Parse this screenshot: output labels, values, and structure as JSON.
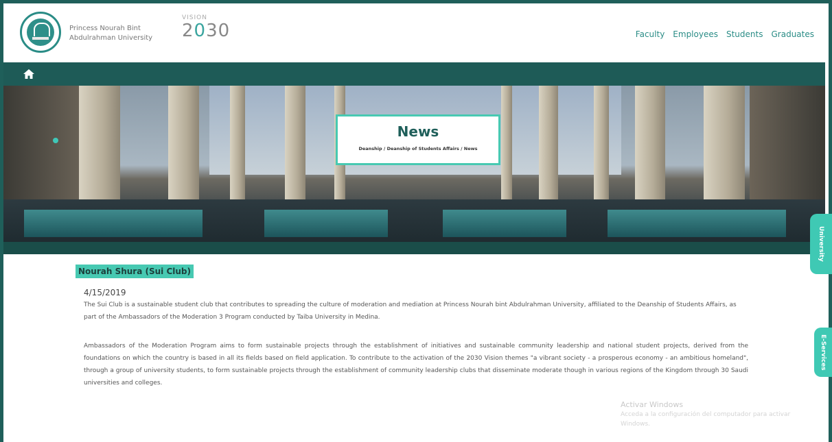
{
  "header": {
    "university_name_line1": "Princess Nourah Bint",
    "university_name_line2": "Abdulrahman University",
    "vision_top": "VISION",
    "vision_number_a": "2",
    "vision_number_b": "0",
    "vision_number_c": "30",
    "nav": [
      "Faculty",
      "Employees",
      "Students",
      "Graduates"
    ]
  },
  "hero": {
    "title": "News",
    "breadcrumb": "Deanship / Deanship of Students Affairs / News"
  },
  "side_tabs": [
    "University",
    "E-Services"
  ],
  "article": {
    "headline": "Nourah Shura (Sui Club)",
    "date": "4/15/2019",
    "paragraph1": "The Sui Club is a sustainable student club that contributes to spreading the culture of moderation and mediation at Princess Nourah bint Abdulrahman University, affiliated to the Deanship of Students Affairs, as part of the Ambassadors of the Moderation 3 Program conducted by Taiba University in Medina.",
    "paragraph2": "Ambassadors of the Moderation Program aims to form sustainable projects through the establishment of initiatives and sustainable community leadership and national student projects, derived from the foundations on which the country is based in all its fields based on field application. To contribute to the activation of the 2030 Vision themes \"a vibrant society - a prosperous economy - an ambitious homeland\", through a group of university students, to form sustainable projects through the establishment of community leadership clubs that disseminate moderate though in various regions of the Kingdom through 30 Saudi universities and colleges."
  },
  "watermark": {
    "line1": "Activar Windows",
    "line2": "Acceda a la configuración del computador para activar Windows."
  },
  "colors": {
    "brand": "#1f5f5a",
    "accent": "#47c9b2",
    "link": "#2a8c86"
  }
}
